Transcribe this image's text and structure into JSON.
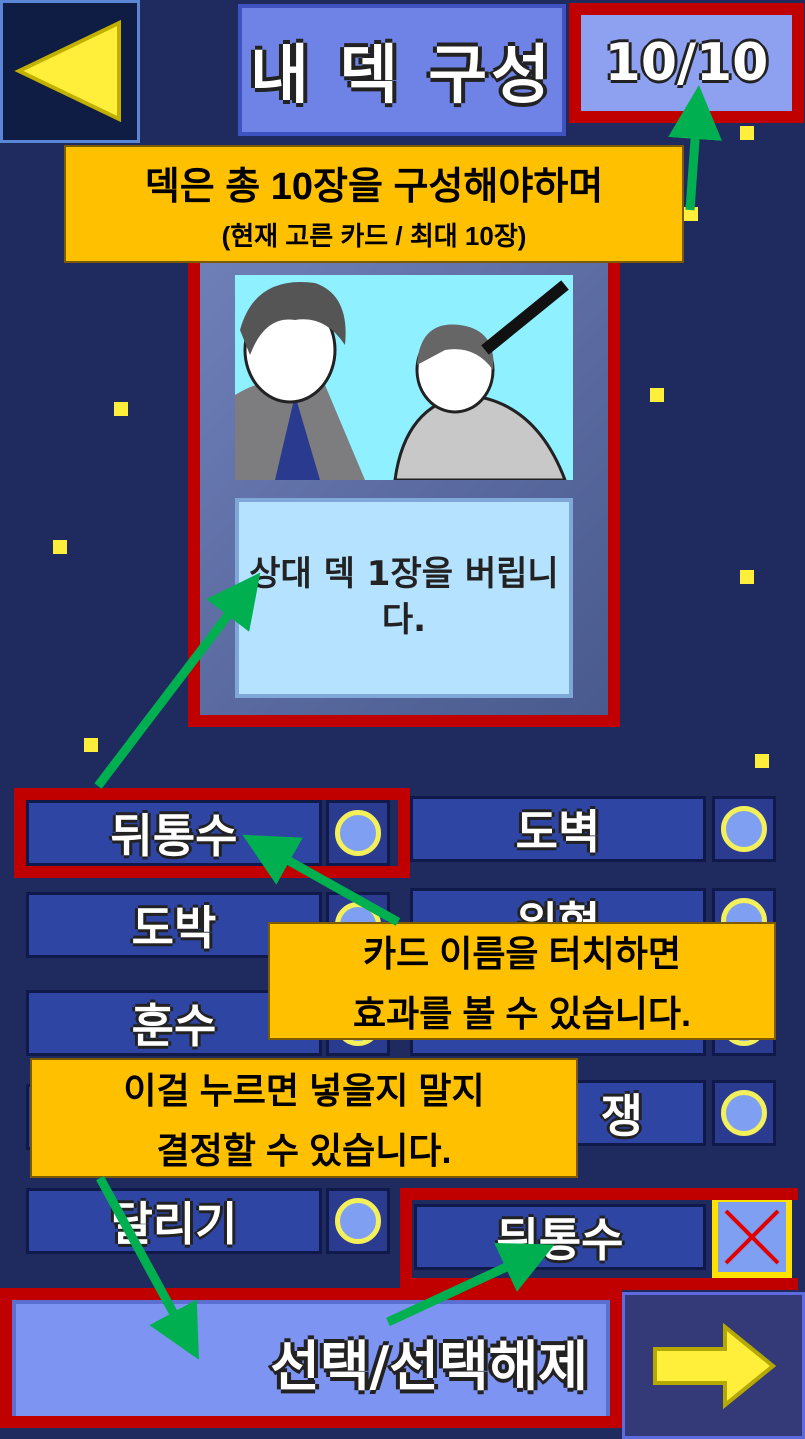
{
  "header": {
    "back_icon": "left-triangle-icon",
    "title": "내 덱 구성",
    "deck_count": "10/10"
  },
  "card_preview": {
    "effect_text": "상대 덱 1장을 버립니다."
  },
  "card_list": [
    {
      "name": "뒤통수",
      "state": "unselected"
    },
    {
      "name": "도벽",
      "state": "unselected"
    },
    {
      "name": "도박",
      "state": "unselected"
    },
    {
      "name": "위협",
      "state": "unselected"
    },
    {
      "name": "훈수",
      "state": "unselected"
    },
    {
      "name": "",
      "state": "unselected"
    },
    {
      "name": "",
      "state": "unselected"
    },
    {
      "name": "쟁",
      "state": "unselected"
    },
    {
      "name": "달리기",
      "state": "unselected"
    },
    {
      "name": "뒤통수",
      "state": "selected-x"
    }
  ],
  "callouts": {
    "deck_rule_line1": "덱은 총 10장을 구성해야하며",
    "deck_rule_line2": "(현재 고른 카드 / 최대 10장)",
    "card_name_line1": "카드 이름을 터치하면",
    "card_name_line2": "효과를 볼 수 있습니다.",
    "toggle_line1": "이걸 누르면 넣을지 말지",
    "toggle_line2": "결정할 수 있습니다."
  },
  "footer": {
    "select_label": "선택/선택해제",
    "next_icon": "right-arrow-icon"
  },
  "colors": {
    "background": "#1f2b5e",
    "highlight_red": "#c00000",
    "callout_yellow": "#ffc000",
    "arrow_green": "#00b050",
    "toggle_ring": "#f4f05a"
  }
}
